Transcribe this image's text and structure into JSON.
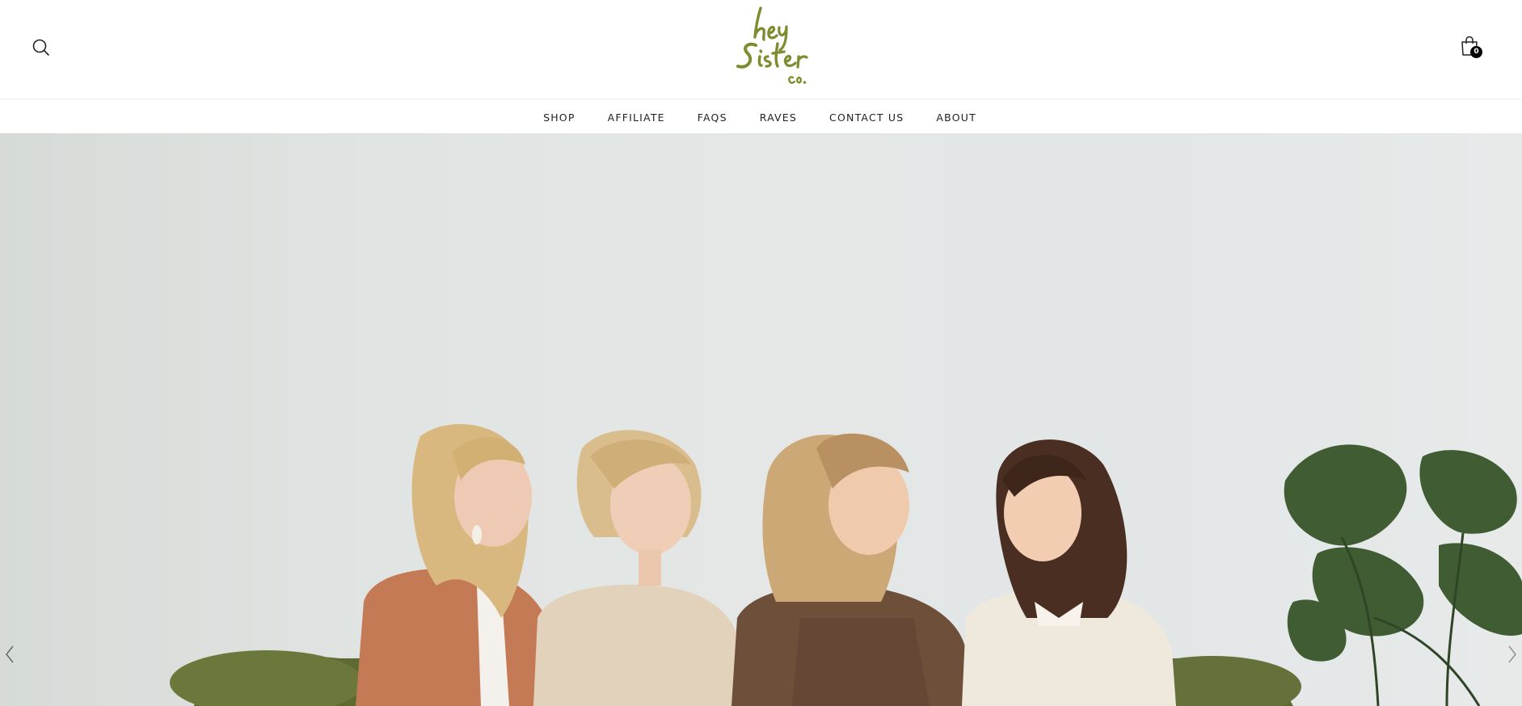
{
  "header": {
    "logo_text": "hey Sister co.",
    "logo_color": "#7f8b2f",
    "search_icon": "search-icon",
    "cart_icon": "shopping-bag-icon",
    "cart_count": "0"
  },
  "nav": {
    "items": [
      {
        "label": "SHOP"
      },
      {
        "label": "AFFILIATE"
      },
      {
        "label": "FAQS"
      },
      {
        "label": "RAVES"
      },
      {
        "label": "CONTACT US"
      },
      {
        "label": "ABOUT"
      }
    ]
  },
  "hero": {
    "slider_prev_icon": "chevron-left-icon",
    "slider_next_icon": "chevron-right-icon"
  }
}
